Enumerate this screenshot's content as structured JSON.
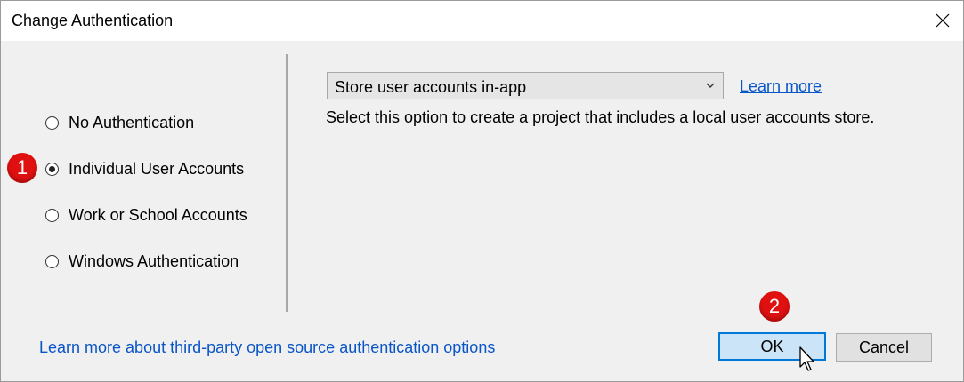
{
  "window": {
    "title": "Change Authentication"
  },
  "auth_options": [
    {
      "label": "No Authentication",
      "selected": false
    },
    {
      "label": "Individual User Accounts",
      "selected": true
    },
    {
      "label": "Work or School Accounts",
      "selected": false
    },
    {
      "label": "Windows Authentication",
      "selected": false
    }
  ],
  "store_select": {
    "value": "Store user accounts in-app"
  },
  "learn_more": "Learn more",
  "description": "Select this option to create a project that includes a local user accounts store.",
  "third_party_link": "Learn more about third-party open source authentication options",
  "buttons": {
    "ok": "OK",
    "cancel": "Cancel"
  },
  "annotations": {
    "step1": "1",
    "step2": "2"
  },
  "colors": {
    "badge": "#e01010",
    "link": "#0a55c7",
    "ok_border": "#0078d7",
    "ok_fill": "#cce4f7"
  }
}
